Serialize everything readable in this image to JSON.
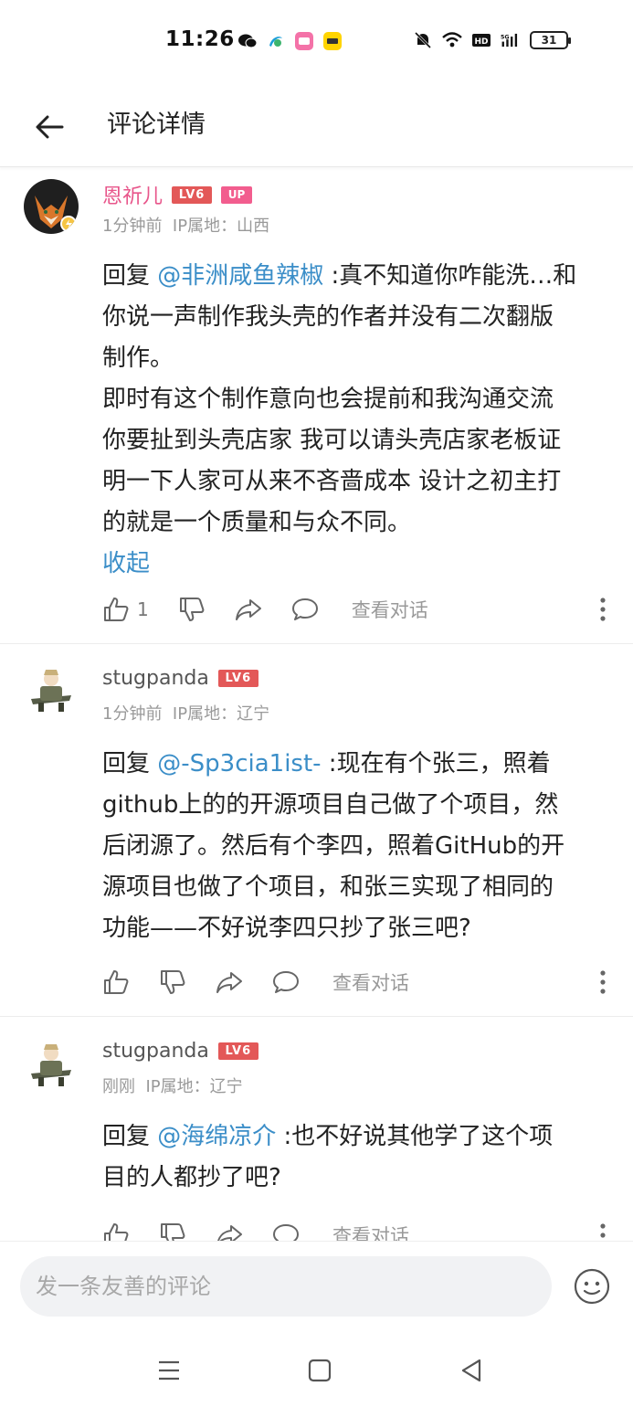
{
  "status_bar": {
    "time": "11:26",
    "battery": "31"
  },
  "header": {
    "title": "评论详情"
  },
  "comments": [
    {
      "username": "恩祈儿",
      "level": "LV6",
      "badge": "UP",
      "time": "1分钟前",
      "ip": "IP属地：山西",
      "reply_prefix": "回复 ",
      "mention": "@非洲咸鱼辣椒",
      "lines": [
        " :真不知道你咋能洗…和",
        "你说一声制作我头壳的作者并没有二次翻版",
        "制作。",
        "即时有这个制作意向也会提前和我沟通交流",
        "你要扯到头壳店家 我可以请头壳店家老板证",
        "明一下人家可从来不吝啬成本 设计之初主打",
        "的就是一个质量和与众不同。"
      ],
      "collapse": "收起",
      "likes": "1",
      "view_conversation": "查看对话"
    },
    {
      "username": "stugpanda",
      "level": "LV6",
      "time": "1分钟前",
      "ip": "IP属地：辽宁",
      "reply_prefix": "回复 ",
      "mention": "@-Sp3cia1ist-",
      "lines": [
        " :现在有个张三，照着",
        "github上的的开源项目自己做了个项目，然",
        "后闭源了。然后有个李四，照着GitHub的开",
        "源项目也做了个项目，和张三实现了相同的",
        "功能——不好说李四只抄了张三吧?"
      ],
      "view_conversation": "查看对话"
    },
    {
      "username": "stugpanda",
      "level": "LV6",
      "time": "刚刚",
      "ip": "IP属地：辽宁",
      "reply_prefix": "回复 ",
      "mention": "@海绵凉介",
      "lines": [
        " :也不好说其他学了这个项",
        "目的人都抄了吧?"
      ],
      "view_conversation": "查看对话"
    }
  ],
  "input": {
    "placeholder": "发一条友善的评论"
  },
  "icons": {
    "back": "back-arrow-icon",
    "like": "thumbs-up-icon",
    "dislike": "thumbs-down-icon",
    "share": "share-icon",
    "reply": "comment-bubble-icon",
    "more": "more-vertical-icon",
    "emoji": "emoji-icon"
  },
  "colors": {
    "accent": "#3b8ec8",
    "name_pink": "#e8568b",
    "level_badge": "#e35858"
  }
}
